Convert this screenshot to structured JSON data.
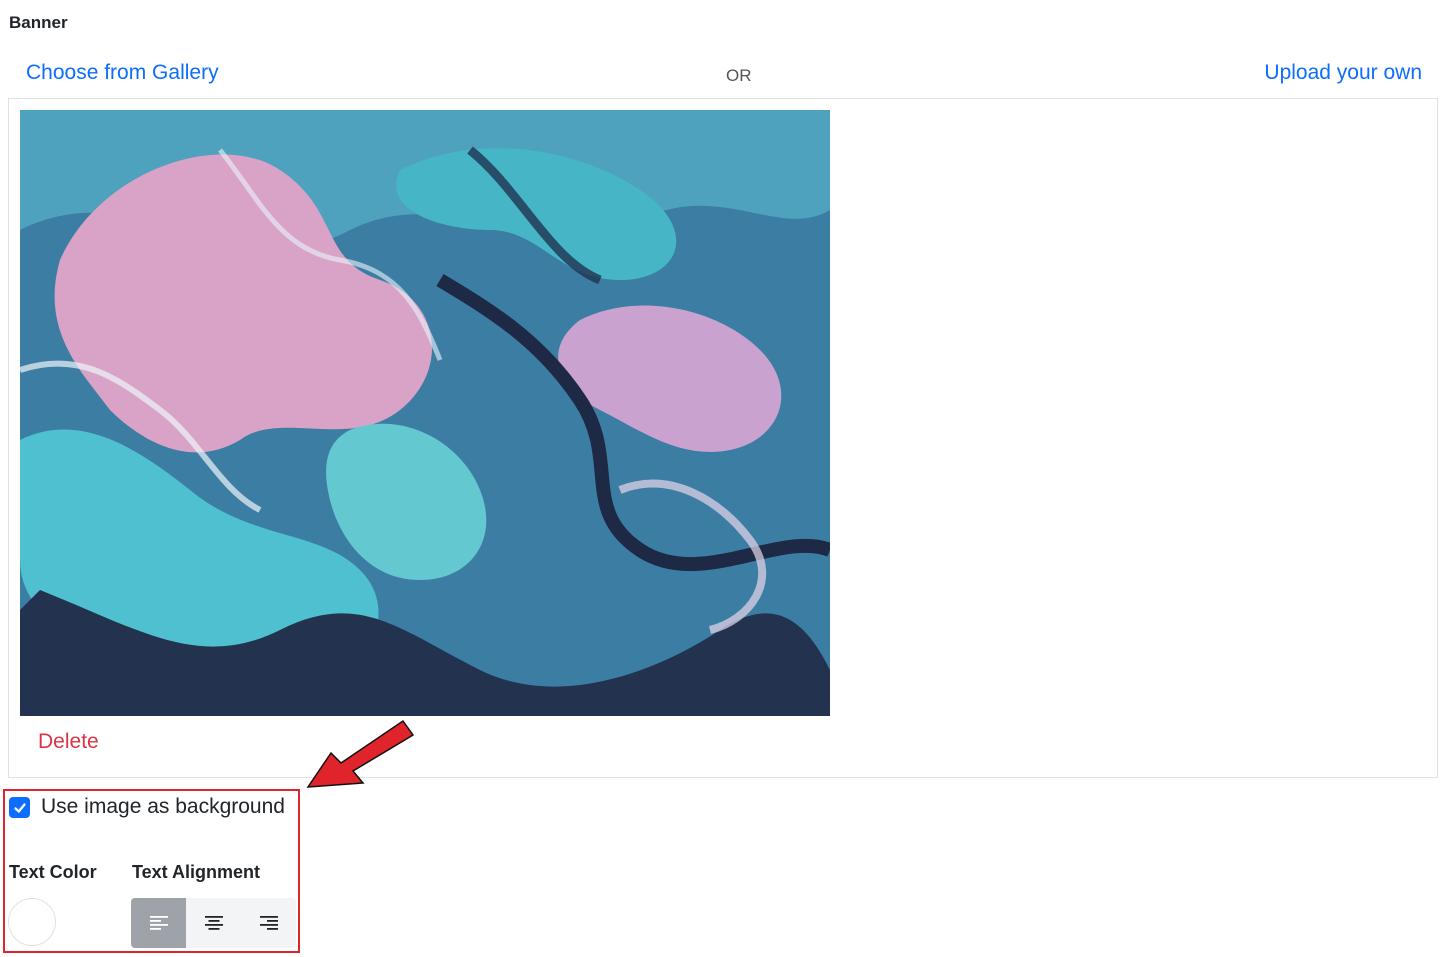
{
  "section": {
    "title": "Banner"
  },
  "actions": {
    "gallery_label": "Choose from Gallery",
    "separator": "OR",
    "upload_label": "Upload your own",
    "delete_label": "Delete"
  },
  "options": {
    "use_image_bg_label": "Use image as background",
    "use_image_bg_checked": true,
    "text_color_label": "Text Color",
    "text_color_value": "#ffffff",
    "text_alignment_label": "Text Alignment",
    "alignment_options": [
      "align-left-icon",
      "align-center-icon",
      "align-right-icon"
    ],
    "alignment_selected": "left"
  },
  "colors": {
    "link": "#0d6efd",
    "danger": "#dc3545",
    "annotation": "#e0242b",
    "checkbox": "#0d6efd"
  }
}
